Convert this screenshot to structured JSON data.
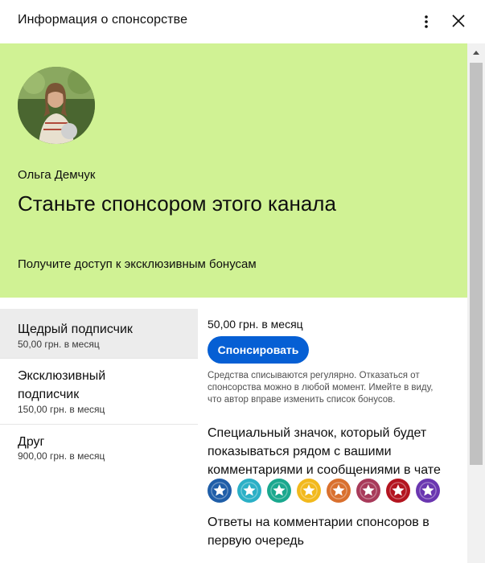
{
  "header": {
    "title": "Информация о спонсорстве"
  },
  "hero": {
    "background": "#d0f294",
    "creator_name": "Ольга Демчук",
    "title": "Станьте спонсором этого канала",
    "subtitle": "Получите доступ к эксклюзивным бонусам"
  },
  "tiers": [
    {
      "name": "Щедрый подписчик",
      "price": "50,00 грн. в месяц",
      "selected": true
    },
    {
      "name": "Эксклюзивный подписчик",
      "price": "150,00 грн. в месяц",
      "selected": false
    },
    {
      "name": "Друг",
      "price": "900,00 грн. в месяц",
      "selected": false
    }
  ],
  "detail": {
    "price_line": "50,00 грн. в месяц",
    "sponsor_button": "Спонсировать",
    "sponsor_button_color": "#065fd4",
    "disclaimer": "Средства списываются регулярно. Отказаться от спонсорства можно в любой момент. Имейте в виду, что автор вправе изменить список бонусов.",
    "perk_badge": "Специальный значок, который будет показываться рядом с вашими комментариями и сообщениями в чате",
    "badge_colors": [
      "#1f5ea8",
      "#2bb0c6",
      "#1aa88e",
      "#f2b91d",
      "#d9702e",
      "#a83a5a",
      "#b3141f",
      "#6a36b0"
    ],
    "perk_replies": "Ответы на комментарии спонсоров в первую очередь"
  }
}
